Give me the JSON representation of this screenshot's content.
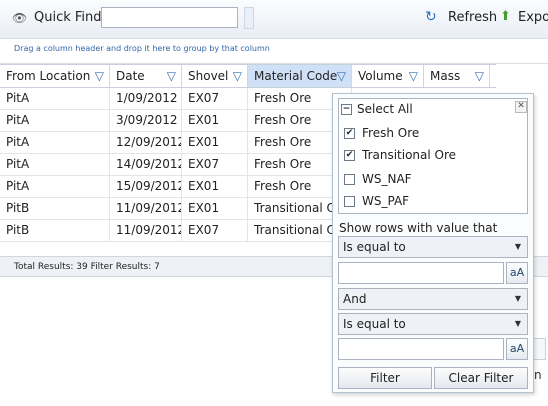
{
  "toolbar": {
    "quick_find_label": "Quick Find:",
    "quick_find_value": "",
    "refresh_label": "Refresh",
    "export_label": "Expo",
    "icons": [
      "binoculars-icon",
      "refresh-icon",
      "export-icon"
    ]
  },
  "group_panel": {
    "hint": "Drag a column header and drop it here to group by that column"
  },
  "columns": [
    "From Location",
    "Date",
    "Shovel",
    "Material Code",
    "Volume",
    "Mass"
  ],
  "rows": [
    [
      "PitA",
      "1/09/2012",
      "EX07",
      "Fresh Ore"
    ],
    [
      "PitA",
      "3/09/2012",
      "EX01",
      "Fresh Ore"
    ],
    [
      "PitA",
      "12/09/2012",
      "EX01",
      "Fresh Ore"
    ],
    [
      "PitA",
      "14/09/2012",
      "EX07",
      "Fresh Ore"
    ],
    [
      "PitA",
      "15/09/2012",
      "EX01",
      "Fresh Ore"
    ],
    [
      "PitB",
      "11/09/2012",
      "EX01",
      "Transitional Or"
    ],
    [
      "PitB",
      "11/09/2012",
      "EX07",
      "Transitional Or"
    ]
  ],
  "footer": {
    "status": "Total Results: 39   Filter Results: 7"
  },
  "filter_popup": {
    "select_all_label": "Select All",
    "options": [
      {
        "label": "Fresh Ore",
        "checked": true
      },
      {
        "label": "Transitional Ore",
        "checked": true
      },
      {
        "label": "WS_NAF",
        "checked": false
      },
      {
        "label": "WS_PAF",
        "checked": false
      }
    ],
    "show_rows_label": "Show rows with value that",
    "condition1": "Is equal to",
    "value1": "",
    "logic": "And",
    "condition2": "Is equal to",
    "value2": "",
    "case_button": "aA",
    "filter_button": "Filter",
    "clear_button": "Clear Filter"
  },
  "colors": {
    "accent": "#3a6fb0",
    "active_header": "#cfe0f7"
  }
}
